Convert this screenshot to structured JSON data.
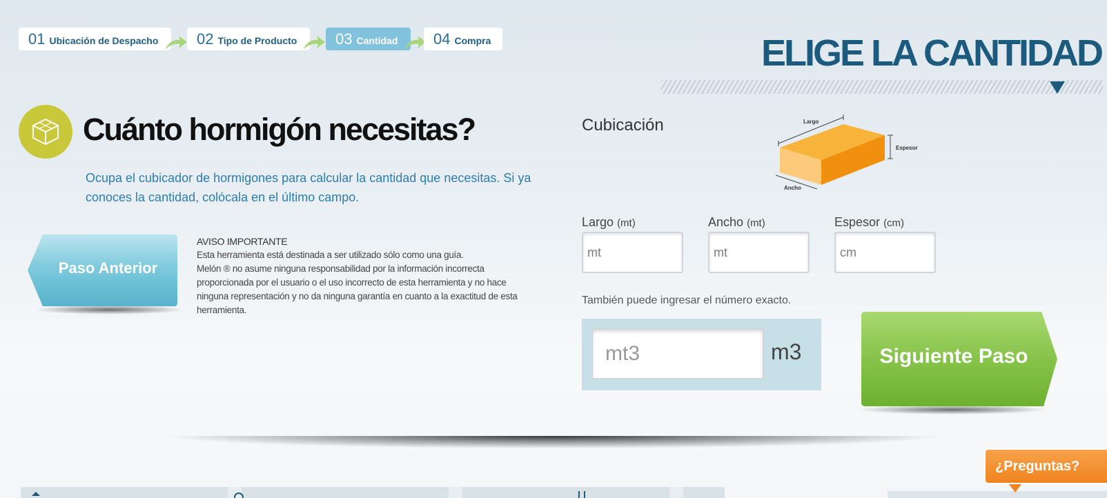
{
  "steps": [
    {
      "num": "01",
      "label": "Ubicación de Despacho"
    },
    {
      "num": "02",
      "label": "Tipo de Producto"
    },
    {
      "num": "03",
      "label": "Cantidad"
    },
    {
      "num": "04",
      "label": "Compra"
    }
  ],
  "header": {
    "title": "ELIGE LA CANTIDAD"
  },
  "main": {
    "question": "Cuánto hormigón necesitas?",
    "intro": "Ocupa el cubicador de hormigones para calcular la cantidad que necesitas. Si ya conoces la cantidad, colócala en el último campo."
  },
  "prev_button": {
    "label": "Paso Anterior"
  },
  "notice": {
    "title": "AVISO IMPORTANTE",
    "line1": "Esta herramienta está destinada a ser utilizado sólo como una guía.",
    "line2": "Melón ® no asume ninguna responsabilidad por la información incorrecta proporcionada por el usuario o el uso incorrecto de esta herramienta y no hace ninguna representación y no da ninguna garantía en cuanto a la exactitud de esta herramienta."
  },
  "cubicacion": {
    "title": "Cubicación",
    "diagram": {
      "largo": "Largo",
      "ancho": "Ancho",
      "espesor": "Espesor"
    },
    "fields": [
      {
        "label": "Largo",
        "unit": "(mt)",
        "placeholder": "mt"
      },
      {
        "label": "Ancho",
        "unit": "(mt)",
        "placeholder": "mt"
      },
      {
        "label": "Espesor",
        "unit": "(cm)",
        "placeholder": "cm"
      }
    ],
    "also_text": "También puede ingresar el número exacto.",
    "exact": {
      "placeholder": "mt3",
      "unit": "m3"
    }
  },
  "next_button": {
    "label": "Siguiente Paso"
  },
  "help": {
    "label": "¿Preguntas?"
  },
  "colors": {
    "primary": "#1d5b7e",
    "accent_blue": "#82c2dc",
    "green": "#86c34a",
    "orange": "#ef8420",
    "olive": "#c9c83a"
  }
}
